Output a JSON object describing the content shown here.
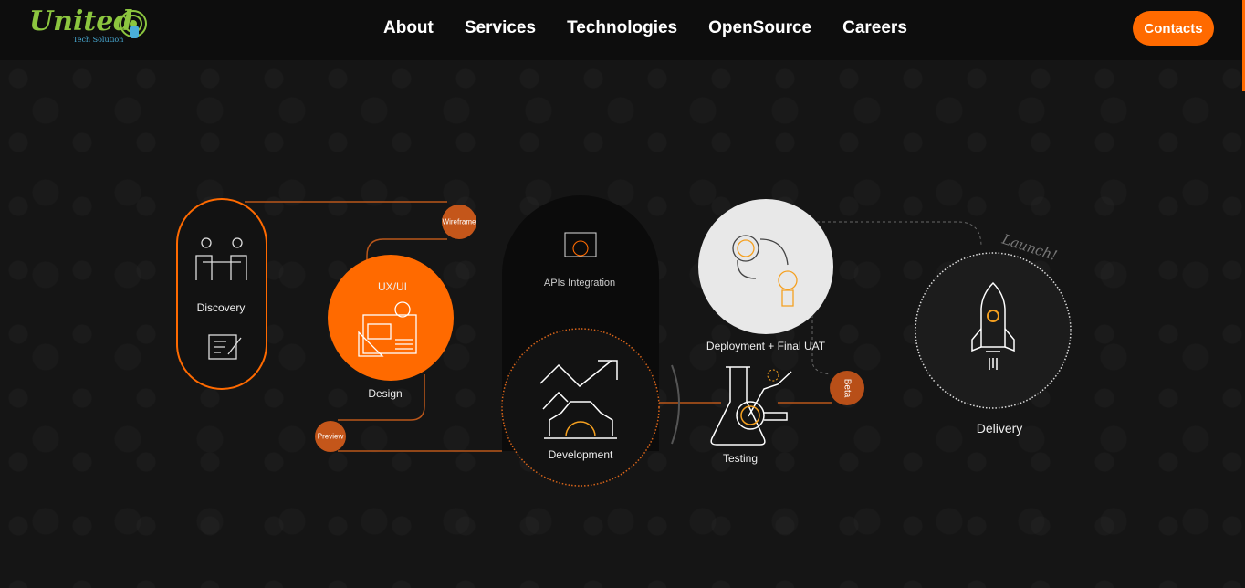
{
  "header": {
    "logo": {
      "name": "United",
      "tagline": "Tech Solution"
    },
    "nav": [
      "About",
      "Services",
      "Technologies",
      "OpenSource",
      "Careers"
    ],
    "contacts_label": "Contacts"
  },
  "process": {
    "discovery": "Discovery",
    "wireframe": "Wireframe",
    "uxui": "UX/UI",
    "design": "Design",
    "preview": "Preview",
    "apis": "APIs Integration",
    "development": "Development",
    "deployment": "Deployment + Final UAT",
    "testing": "Testing",
    "beta": "Beta",
    "launch": "Launch!",
    "delivery": "Delivery"
  },
  "colors": {
    "accent": "#ff6a00",
    "badge": "#c4561a",
    "background": "#141414",
    "header": "#0d0d0d"
  }
}
